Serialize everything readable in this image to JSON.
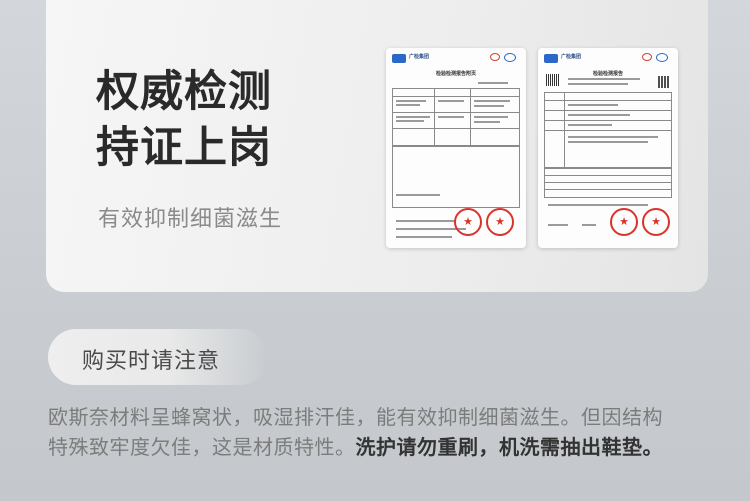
{
  "card": {
    "headline_line1": "权威检测",
    "headline_line2": "持证上岗",
    "subline": "有效抑制细菌滋生",
    "report1": {
      "org": "广检集团",
      "title": "检验检测报告附页"
    },
    "report2": {
      "org": "广检集团",
      "title": "检验检测报告"
    }
  },
  "notice": {
    "label": "购买时请注意",
    "text_line1": "欧斯奈材料呈蜂窝状，吸湿排汗佳，能有效抑制细菌滋生。但因结构",
    "text_line2a": "特殊致牢度欠佳，这是材质特性。",
    "text_line2b": "洗护请勿重刷，机洗需抽出鞋垫。"
  },
  "colors": {
    "seal_red": "#d9342b",
    "logo_blue": "#2c68c7"
  }
}
